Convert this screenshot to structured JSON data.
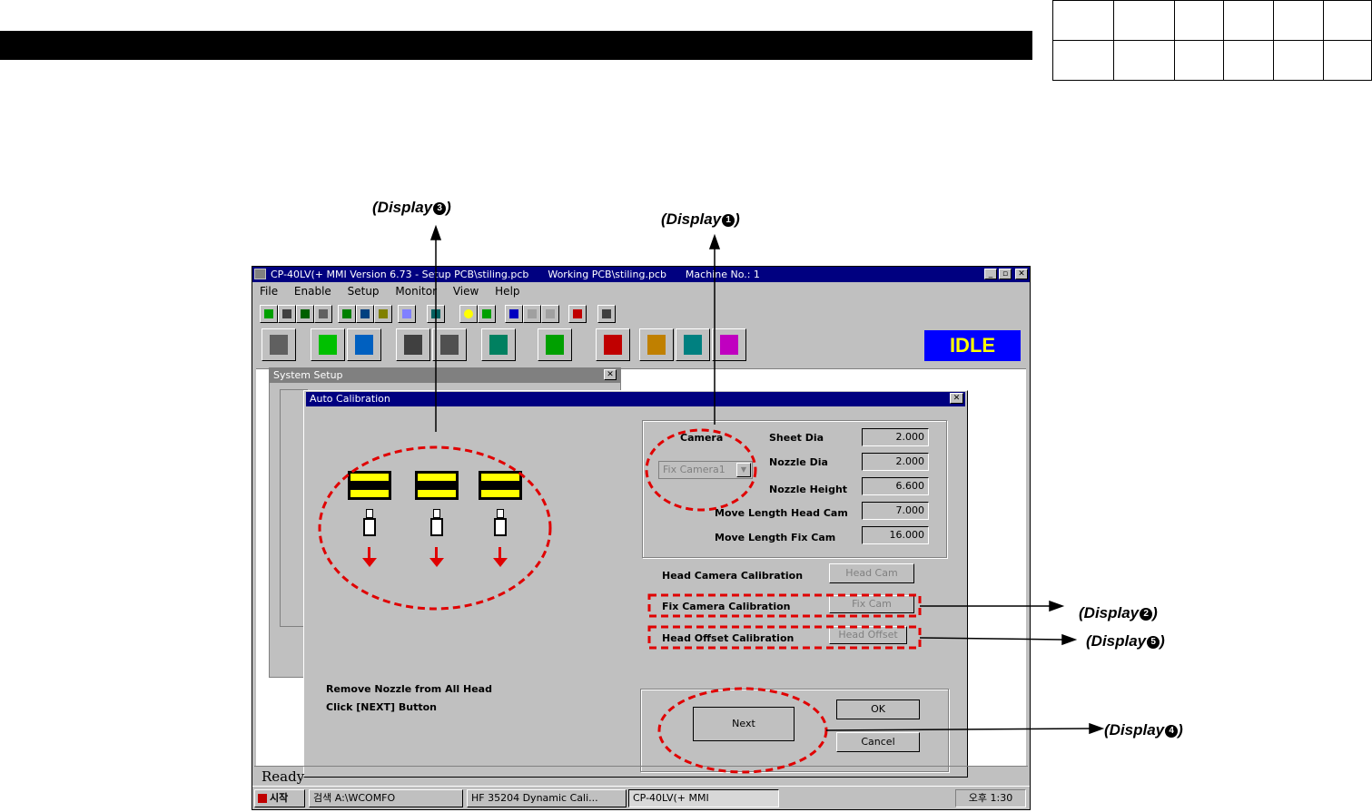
{
  "annotations": {
    "display_1": {
      "label": "(Display",
      "mark": "1"
    },
    "display_2": {
      "label": "(Display",
      "mark": "2"
    },
    "display_3": {
      "label": "(Display",
      "mark": "3"
    },
    "display_4": {
      "label": "(Display",
      "mark": "4"
    },
    "display_5": {
      "label": "(Display",
      "mark": "5"
    },
    "close_paren": ")"
  },
  "app": {
    "title": "CP-40LV(+ MMI Version 6.73 - Setup PCB\\stiling.pcb      Working PCB\\stiling.pcb      Machine No.: 1",
    "menu": [
      "File",
      "Enable",
      "Setup",
      "Monitor",
      "View",
      "Help"
    ],
    "status_label": "IDLE",
    "status_color": "#0000ff",
    "status_text_color": "#ffff00",
    "statusbar_text": "Ready"
  },
  "system_setup": {
    "title": "System Setup"
  },
  "auto_calibration": {
    "title": "Auto Calibration",
    "camera_label": "Camera",
    "camera_select": "Fix Camera1",
    "fields": [
      {
        "label": "Sheet Dia",
        "value": "2.000"
      },
      {
        "label": "Nozzle Dia",
        "value": "2.000"
      },
      {
        "label": "Nozzle Height",
        "value": "6.600"
      },
      {
        "label": "Move Length Head Cam",
        "value": "7.000"
      },
      {
        "label": "Move Length Fix Cam",
        "value": "16.000"
      }
    ],
    "calibrations": [
      {
        "label": "Head Camera Calibration",
        "button": "Head Cam"
      },
      {
        "label": "Fix Camera Calibration",
        "button": "Fix Cam"
      },
      {
        "label": "Head Offset Calibration",
        "button": "Head Offset"
      }
    ],
    "instructions": [
      "Remove Nozzle from All Head",
      "Click [NEXT] Button"
    ],
    "next_button": "Next",
    "ok_button": "OK",
    "cancel_button": "Cancel"
  },
  "taskbar": {
    "start": "시작",
    "items": [
      "검색   A:\\WCOMFO",
      "HF 35204 Dynamic Cali...",
      "CP-40LV(+ MMI"
    ],
    "clock": "오후 1:30"
  },
  "colors": {
    "annotation": "#e00000",
    "title_active": "#000080",
    "window_bg": "#c0c0c0"
  }
}
